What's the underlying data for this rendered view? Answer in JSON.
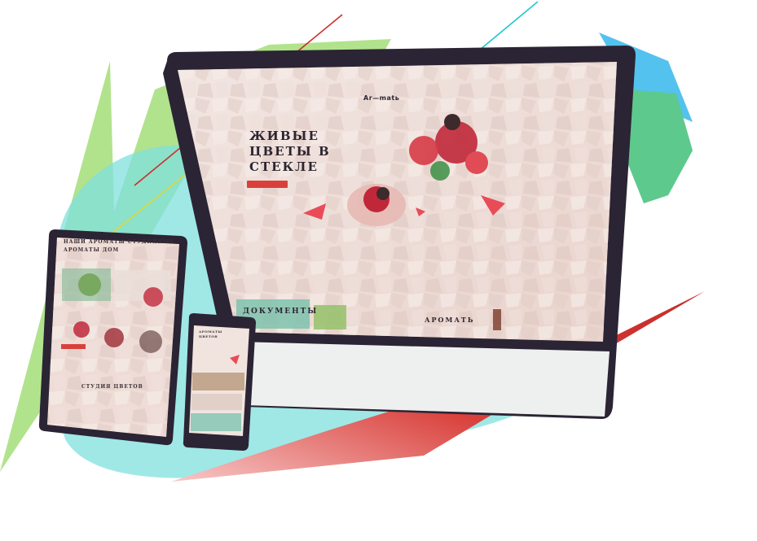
{
  "illustration": {
    "desktop_site": {
      "logo": "Ar—matь",
      "hero_title": "ЖИВЫЕ ЦВЕТЫ В СТЕКЛЕ",
      "section_label": "ДОКУМЕНТЫ",
      "section_label_2": "АРОМАТЬ"
    },
    "tablet_site": {
      "heading": "НАШИ АРОМАТЫ СТУДИЙНЫЕ АРОМАТЫ ДОМ",
      "footer": "СТУДИЯ ЦВЕТОВ"
    },
    "phone_site": {
      "heading": "АРОМАТЫ ЦВЕТОВ"
    },
    "colors": {
      "green": "#a8e07f",
      "teal": "#7fe0de",
      "blue": "#54c2ee",
      "emerald": "#5ec98d",
      "red": "#d9403b",
      "frame": "#2b2434",
      "screen": "#efdcd6",
      "red_line": "#d02b2b",
      "cyan_line": "#21c7d3",
      "yellow_line": "#dcd93a"
    }
  }
}
